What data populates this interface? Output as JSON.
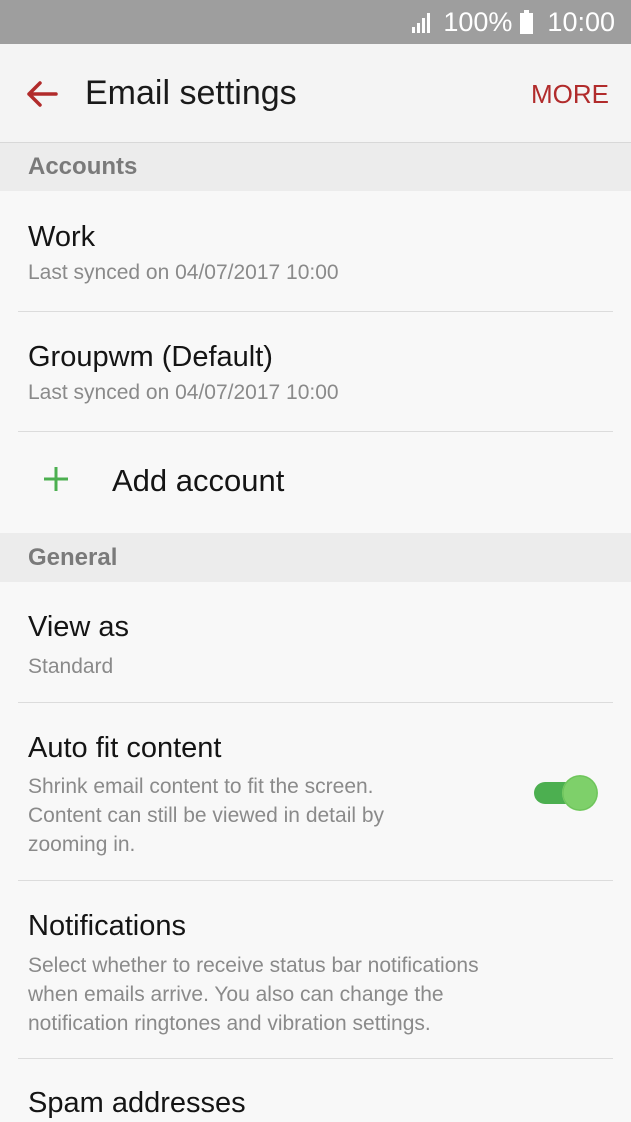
{
  "status_bar": {
    "battery_percent": "100%",
    "time": "10:00",
    "signal_icon": "signal-icon",
    "battery_icon": "battery-icon"
  },
  "app_bar": {
    "title": "Email settings",
    "more_label": "MORE",
    "back_icon": "back-arrow-icon",
    "accent_color": "#b12b2b"
  },
  "accounts": {
    "header": "Accounts",
    "items": [
      {
        "name": "Work",
        "subtitle": "Last synced on 04/07/2017 10:00"
      },
      {
        "name": "Groupwm (Default)",
        "subtitle": "Last synced on 04/07/2017 10:00"
      }
    ],
    "add_label": "Add account",
    "add_icon": "plus-icon",
    "add_color": "#4caf50"
  },
  "general": {
    "header": "General",
    "view_as": {
      "title": "View as",
      "value": "Standard"
    },
    "auto_fit": {
      "title": "Auto fit content",
      "line1": "Shrink email content to fit the screen.",
      "line2": "Content can still be viewed in detail by",
      "line3": "zooming in.",
      "enabled": true,
      "toggle_color": "#4caf50"
    },
    "notifications": {
      "title": "Notifications",
      "line1": "Select whether to receive status bar notifications",
      "line2": "when emails arrive. You also can change the",
      "line3": "notification ringtones and vibration settings."
    },
    "spam": {
      "title": "Spam addresses"
    }
  }
}
